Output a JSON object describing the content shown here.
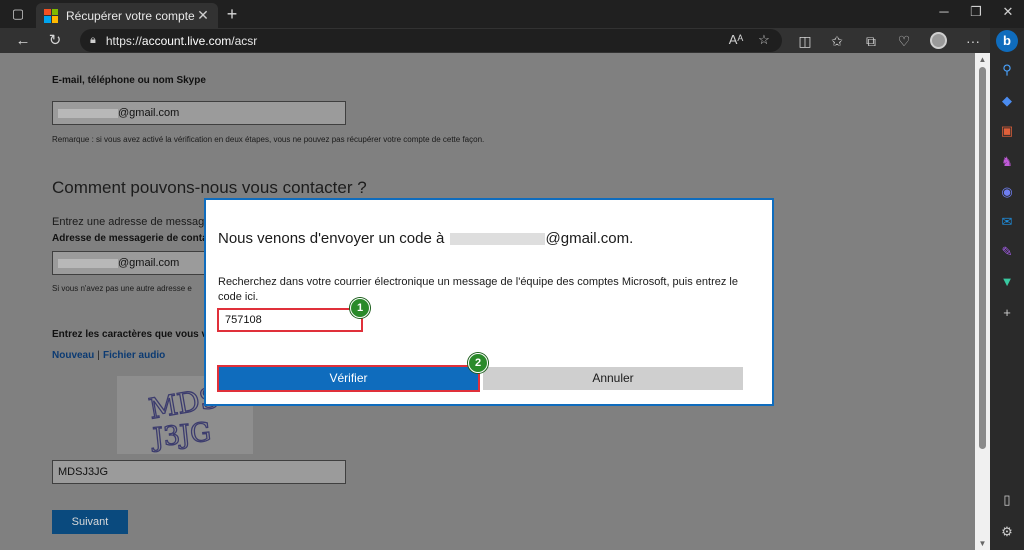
{
  "browser": {
    "tab_title": "Récupérer votre compte",
    "url_prefix": "https://",
    "url_host": "account.live.com",
    "url_path": "/acsr",
    "icons": [
      "tab-actions-icon",
      "close-icon",
      "plus-icon",
      "minimize-icon",
      "restore-icon",
      "window-close-icon",
      "back-icon",
      "refresh-icon",
      "lock-icon",
      "read-aloud-icon",
      "favorite-star-icon",
      "split-screen-icon",
      "favorites-icon",
      "collections-icon",
      "extensions-icon",
      "profile-avatar",
      "more-icon",
      "bing-icon"
    ]
  },
  "page": {
    "email_label": "E-mail, téléphone ou nom Skype",
    "email_value": "@gmail.com",
    "note": "Remarque : si vous avez activé la vérification en deux étapes, vous ne pouvez pas récupérer votre compte de cette façon.",
    "contact_heading": "Comment pouvons-nous vous contacter ?",
    "contact_intro": "Entrez une adresse de messag",
    "contact_label": "Adresse de messagerie de contac",
    "contact_value": "@gmail.com",
    "contact_note": "Si vous n'avez pas une autre adresse e",
    "captcha_label": "Entrez les caractères que vous vo",
    "captcha_new": "Nouveau",
    "captcha_sep": "|",
    "captcha_audio": "Fichier audio",
    "captcha_value": "MDSJ3JG",
    "next_label": "Suivant"
  },
  "dialog": {
    "title_prefix": "Nous venons d'envoyer un code à ",
    "title_suffix": "@gmail.com.",
    "message": "Recherchez dans votre courrier électronique un message de l'équipe des comptes Microsoft, puis entrez le code ici.",
    "code_value": "757108",
    "verify_label": "Vérifier",
    "cancel_label": "Annuler",
    "badge_1": "1",
    "badge_2": "2"
  },
  "colors": {
    "accent": "#0f6cbd",
    "highlight": "#e0303a",
    "badge": "#2a8a2a",
    "overlay": "#808080"
  }
}
